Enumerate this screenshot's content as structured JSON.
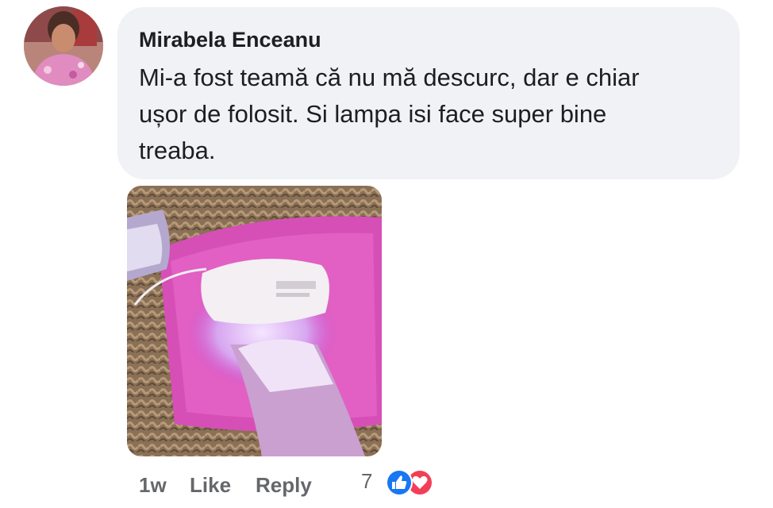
{
  "comment": {
    "author": "Mirabela Enceanu",
    "text": "Mi-a fost teamă că nu mă descurc, dar e chiar ușor de folosit. Si lampa isi face super bine treaba.",
    "time": "1w",
    "like_label": "Like",
    "reply_label": "Reply",
    "reaction_count": "7",
    "reactions": [
      "like-icon",
      "love-icon"
    ]
  },
  "colors": {
    "bubble": "#f0f2f5",
    "text": "#1c1e21",
    "secondary": "#65676b",
    "like": "#1877f2",
    "love": "#f33e58"
  }
}
